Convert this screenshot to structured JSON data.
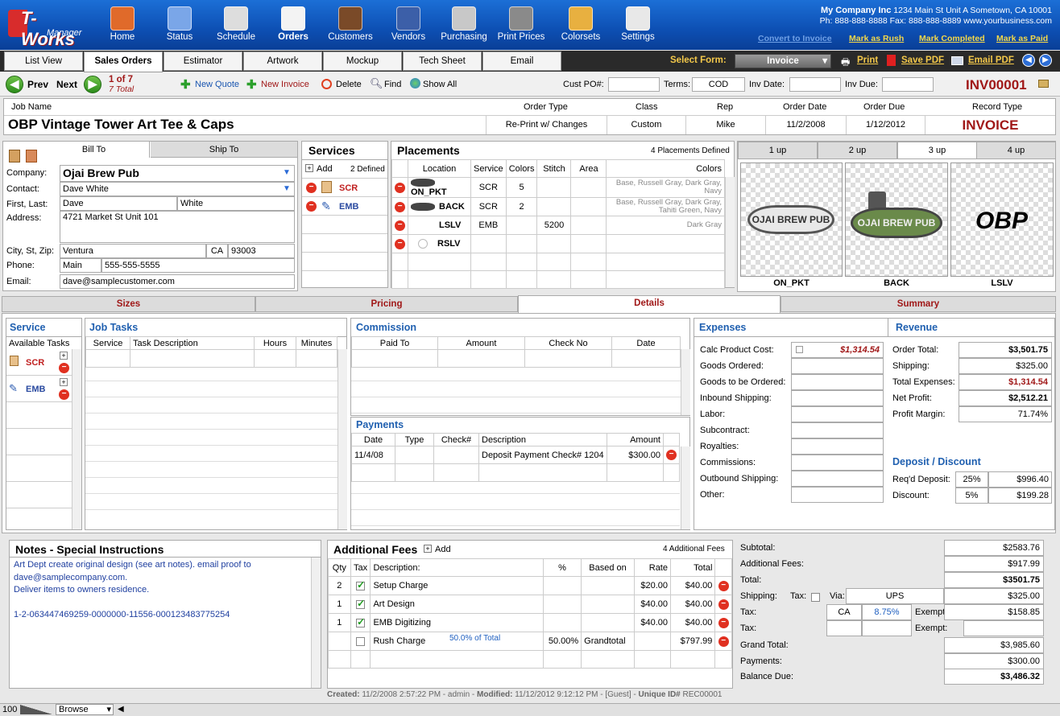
{
  "app": {
    "logo_name": "T-Works",
    "logo_sub": "Manager"
  },
  "nav": [
    {
      "label": "Home",
      "icon": "home-icon",
      "color": "#e06a2a"
    },
    {
      "label": "Status",
      "icon": "flag-icon",
      "color": "#7aa6e8"
    },
    {
      "label": "Schedule",
      "icon": "calendar-icon",
      "color": "#dddddd"
    },
    {
      "label": "Orders",
      "icon": "pencil-icon",
      "color": "#f3f3f3"
    },
    {
      "label": "Customers",
      "icon": "book-icon",
      "color": "#7a4a28"
    },
    {
      "label": "Vendors",
      "icon": "shirt-icon",
      "color": "#3c5fa8"
    },
    {
      "label": "Purchasing",
      "icon": "basket-icon",
      "color": "#c8c8c8"
    },
    {
      "label": "Print Prices",
      "icon": "calculator-icon",
      "color": "#8a8a8a"
    },
    {
      "label": "Colorsets",
      "icon": "palette-icon",
      "color": "#e8b040"
    },
    {
      "label": "Settings",
      "icon": "switch-icon",
      "color": "#e8e8e8"
    }
  ],
  "company": {
    "name": "My Company Inc",
    "addr": "1234 Main St Unit A Sometown, CA 10001",
    "phone": "Ph: 888-888-8888 Fax: 888-888-8889 www.yourbusiness.com"
  },
  "actions": {
    "convert": "Convert to Invoice",
    "rush": "Mark as Rush",
    "completed": "Mark Completed",
    "paid": "Mark as Paid"
  },
  "tabs": [
    "List View",
    "Sales Orders",
    "Estimator",
    "Artwork",
    "Mockup",
    "Tech Sheet",
    "Email"
  ],
  "formbar": {
    "select_label": "Select Form:",
    "form": "Invoice",
    "print": "Print",
    "save_pdf": "Save PDF",
    "email_pdf": "Email PDF"
  },
  "toolbar": {
    "prev": "Prev",
    "next": "Next",
    "count": "1 of 7",
    "total": "7 Total",
    "new_quote": "New Quote",
    "new_invoice": "New Invoice",
    "delete": "Delete",
    "find": "Find",
    "show_all": "Show All",
    "cust_po_label": "Cust PO#:",
    "cust_po": "",
    "terms_label": "Terms:",
    "terms": "COD",
    "inv_date_label": "Inv Date:",
    "inv_date": "",
    "inv_due_label": "Inv Due:",
    "inv_due": "",
    "inv_number": "INV00001"
  },
  "job": {
    "h_name": "Job Name",
    "h_type": "Order Type",
    "h_class": "Class",
    "h_rep": "Rep",
    "h_odate": "Order Date",
    "h_due": "Order Due",
    "h_rtype": "Record Type",
    "name": "OBP Vintage Tower Art Tee & Caps",
    "type": "Re-Print w/ Changes",
    "class": "Custom",
    "rep": "Mike",
    "odate": "11/2/2008",
    "due": "1/12/2012",
    "rtype": "INVOICE"
  },
  "bill": {
    "tab_bill": "Bill To",
    "tab_ship": "Ship To",
    "l_company": "Company:",
    "company": "Ojai Brew Pub",
    "l_contact": "Contact:",
    "contact": "Dave White",
    "l_first": "First, Last:",
    "first": "Dave",
    "last": "White",
    "l_addr": "Address:",
    "addr": "4721 Market St Unit 101",
    "l_city": "City, St, Zip:",
    "city": "Ventura",
    "st": "CA",
    "zip": "93003",
    "l_phone": "Phone:",
    "phone_type": "Main",
    "phone": "555-555-5555",
    "l_email": "Email:",
    "email": "dave@samplecustomer.com"
  },
  "services": {
    "title": "Services",
    "add": "Add",
    "defined": "2 Defined",
    "items": [
      "SCR",
      "EMB"
    ]
  },
  "placements": {
    "title": "Placements",
    "defined": "4 Placements Defined",
    "cols": [
      "Location",
      "Service",
      "Colors",
      "Stitch",
      "Area",
      "Colors"
    ],
    "rows": [
      {
        "loc": "ON_PKT",
        "svc": "SCR",
        "colors": "5",
        "stitch": "",
        "area": "",
        "cl": "Base, Russell Gray, Dark Gray, Navy"
      },
      {
        "loc": "BACK",
        "svc": "SCR",
        "colors": "2",
        "stitch": "",
        "area": "",
        "cl": "Base, Russell Gray, Dark Gray, Tahiti Green, Navy"
      },
      {
        "loc": "LSLV",
        "svc": "EMB",
        "colors": "",
        "stitch": "5200",
        "area": "",
        "cl": "Dark Gray"
      },
      {
        "loc": "RSLV",
        "svc": "",
        "colors": "",
        "stitch": "",
        "area": "",
        "cl": ""
      }
    ]
  },
  "mockup": {
    "tabs": [
      "1 up",
      "2 up",
      "3 up",
      "4 up"
    ],
    "labels": [
      "ON_PKT",
      "BACK",
      "LSLV"
    ],
    "art1": "OJAI BREW PUB",
    "art3": "OBP"
  },
  "subtabs": [
    "Sizes",
    "Pricing",
    "Details",
    "Summary"
  ],
  "svcpanel": {
    "title": "Service",
    "available": "Available Tasks",
    "items": [
      "SCR",
      "EMB"
    ]
  },
  "jobtasks": {
    "title": "Job Tasks",
    "cols": [
      "Service",
      "Task Description",
      "Hours",
      "Minutes"
    ]
  },
  "commission": {
    "title": "Commission",
    "cols": [
      "Paid To",
      "Amount",
      "Check No",
      "Date"
    ]
  },
  "payments": {
    "title": "Payments",
    "cols": [
      "Date",
      "Type",
      "Check#",
      "Description",
      "Amount"
    ],
    "rows": [
      {
        "date": "11/4/08",
        "type": "",
        "check": "",
        "desc": "Deposit Payment Check# 1204",
        "amount": "$300.00"
      }
    ]
  },
  "expenses": {
    "title": "Expenses",
    "rows": [
      {
        "label": "Calc Product Cost:",
        "value": "$1,314.54"
      },
      {
        "label": "Goods Ordered:",
        "value": ""
      },
      {
        "label": "Goods to be Ordered:",
        "value": ""
      },
      {
        "label": "Inbound Shipping:",
        "value": ""
      },
      {
        "label": "Labor:",
        "value": ""
      },
      {
        "label": "Subcontract:",
        "value": ""
      },
      {
        "label": "Royalties:",
        "value": ""
      },
      {
        "label": "Commissions:",
        "value": ""
      },
      {
        "label": "Outbound Shipping:",
        "value": ""
      },
      {
        "label": "Other:",
        "value": ""
      }
    ]
  },
  "revenue": {
    "title": "Revenue",
    "rows": [
      {
        "label": "Order Total:",
        "value": "$3,501.75"
      },
      {
        "label": "Shipping:",
        "value": "$325.00"
      },
      {
        "label": "Total Expenses:",
        "value": "$1,314.54"
      },
      {
        "label": "Net Profit:",
        "value": "$2,512.21"
      },
      {
        "label": "Profit Margin:",
        "value": "71.74%"
      }
    ]
  },
  "deposit": {
    "title": "Deposit / Discount",
    "req_label": "Req'd Deposit:",
    "req_pct": "25%",
    "req_val": "$996.40",
    "disc_label": "Discount:",
    "disc_pct": "5%",
    "disc_val": "$199.28"
  },
  "notes": {
    "title": "Notes - Special Instructions",
    "l1": "Art Dept create original design (see art notes). email proof to",
    "l2": "dave@samplecompany.com.",
    "l3": "Deliver items to owners residence.",
    "l4": "1-2-063447469259-0000000-11556-000123483775254"
  },
  "fees": {
    "title": "Additional Fees",
    "add": "Add",
    "count": "4 Additional Fees",
    "cols": [
      "Qty",
      "Tax",
      "Description:",
      "%",
      "Based on",
      "Rate",
      "Total"
    ],
    "rows": [
      {
        "qty": "2",
        "tax": true,
        "desc": "Setup Charge",
        "pct": "",
        "based": "",
        "rate": "$20.00",
        "total": "$40.00"
      },
      {
        "qty": "1",
        "tax": true,
        "desc": "Art Design",
        "pct": "",
        "based": "",
        "rate": "$40.00",
        "total": "$40.00"
      },
      {
        "qty": "1",
        "tax": true,
        "desc": "EMB Digitizing",
        "pct": "",
        "based": "",
        "rate": "$40.00",
        "total": "$40.00"
      },
      {
        "qty": "",
        "tax": false,
        "desc": "Rush Charge",
        "pct": "50.00%",
        "based": "Grandtotal",
        "rate": "",
        "total": "$797.99",
        "note": "50.0% of Total"
      }
    ]
  },
  "totals": {
    "subtotal_l": "Subtotal:",
    "subtotal": "$2583.76",
    "fees_l": "Additional Fees:",
    "fees": "$917.99",
    "total_l": "Total:",
    "total": "$3501.75",
    "ship_l": "Shipping:",
    "tax_l": "Tax:",
    "via_l": "Via:",
    "via": "UPS",
    "ship": "$325.00",
    "tax1_l": "Tax:",
    "tax1_st": "CA",
    "tax1_rate": "8.75%",
    "exempt_l": "Exempt:",
    "tax1": "$158.85",
    "tax2_l": "Tax:",
    "gt_l": "Grand Total:",
    "gt": "$3,985.60",
    "pay_l": "Payments:",
    "pay": "$300.00",
    "bal_l": "Balance Due:",
    "bal": "$3,486.32"
  },
  "footer": {
    "created_l": "Created:",
    "created": "11/2/2008 2:57:22 PM - admin",
    "modified_l": "Modified:",
    "modified": "11/12/2012 9:12:12 PM - [Guest]",
    "uid_l": "Unique ID#",
    "uid": "REC00001"
  },
  "status": {
    "zoom": "100",
    "mode": "Browse"
  }
}
